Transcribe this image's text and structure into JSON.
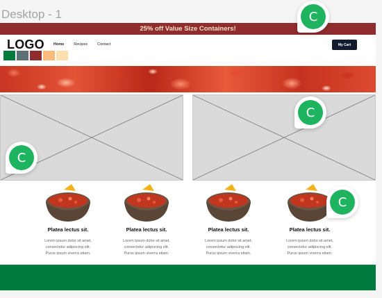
{
  "canvas": {
    "frame_label": "Desktop - 1"
  },
  "promo": {
    "text": "25% off Value Size Containers!"
  },
  "header": {
    "logo": "LOGO",
    "swatch_colors": [
      "#017a3d",
      "#5f6f76",
      "#8f2c2e",
      "#f9bc7d",
      "#fde0ae"
    ],
    "nav": [
      "Home",
      "Recipes",
      "Contact"
    ],
    "cart_label": "My Cart"
  },
  "products": [
    {
      "title": "Platea lectus sit.",
      "desc": [
        "Lorem ipsum dolor sit amet,",
        "consectetur adipiscing elit.",
        "Purus ipsum viverra etiam."
      ]
    },
    {
      "title": "Platea lectus sit.",
      "desc": [
        "Lorem ipsum dolor sit amet,",
        "consectetur adipiscing elit.",
        "Purus ipsum viverra etiam."
      ]
    },
    {
      "title": "Platea lectus sit.",
      "desc": [
        "Lorem ipsum dolor sit amet,",
        "consectetur adipiscing elit.",
        "Purus ipsum viverra etiam."
      ]
    },
    {
      "title": "Platea lectus sit.",
      "desc": [
        "Lorem ipsum dolor sit amet,",
        "consectetur adipiscing elit.",
        "Purus ipsum viverra etiam."
      ]
    }
  ],
  "collaborators": [
    {
      "initial": "C"
    },
    {
      "initial": "C"
    },
    {
      "initial": "C"
    },
    {
      "initial": "C"
    }
  ],
  "colors": {
    "promo_bg": "#8f2c2e",
    "brand_green": "#017a3d",
    "cart_bg": "#121a2e",
    "avatar_green": "#1db35f"
  }
}
